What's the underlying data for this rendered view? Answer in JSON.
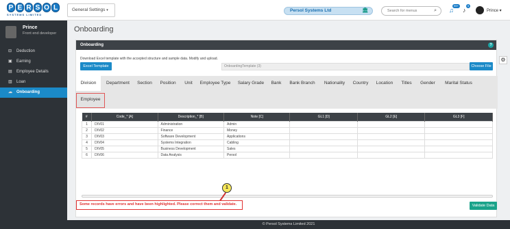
{
  "header": {
    "logo_text": "PERSOL",
    "logo_sub": "SYSTEMS LIMITED",
    "settings_menu": "General Settings",
    "company": "Persol Systems Ltd",
    "search_placeholder": "Search for menus",
    "notif_count": "99+",
    "alerts_count": "5",
    "user": "Prince"
  },
  "sidebar": {
    "name": "Prince",
    "role": "Front end developer",
    "items": [
      {
        "label": "Deduction",
        "icon": "minus-square-icon"
      },
      {
        "label": "Earning",
        "icon": "money-icon"
      },
      {
        "label": "Employee Details",
        "icon": "id-card-icon"
      },
      {
        "label": "Loan",
        "icon": "loan-icon"
      },
      {
        "label": "Onboarding",
        "icon": "cloud-upload-icon",
        "active": true
      }
    ]
  },
  "main": {
    "title": "Onboarding",
    "panel_title": "Onboarding",
    "download_text": "Download Excel template with the accepted structure and sample data. Modify and upload.",
    "excel_button": "Excel Template",
    "file_name": "OnboardingTemplate (3)",
    "choose_button": "Choose File",
    "tabs": [
      "Division",
      "Department",
      "Section",
      "Position",
      "Unit",
      "Employee Type",
      "Salary Grade",
      "Bank",
      "Bank Branch",
      "Nationality",
      "Country",
      "Location",
      "Titles",
      "Gender",
      "Marital Status"
    ],
    "tab_employee": "Employee",
    "table": {
      "headers": [
        "#",
        "Code_* [A]",
        "Description_* [B]",
        "Note [C]",
        "GL1 [D]",
        "GL2 [E]",
        "GL3 [F]"
      ],
      "rows": [
        [
          "1",
          "DIV01",
          "Administration",
          "Admin",
          "",
          "",
          ""
        ],
        [
          "2",
          "DIV02",
          "Finance",
          "Money",
          "",
          "",
          ""
        ],
        [
          "3",
          "DIV03",
          "Software Development",
          "Applications",
          "",
          "",
          ""
        ],
        [
          "4",
          "DIV04",
          "Systems Integration",
          "Cabling",
          "",
          "",
          ""
        ],
        [
          "5",
          "DIV05",
          "Business Development",
          "Sales",
          "",
          "",
          ""
        ],
        [
          "6",
          "DIV06",
          "Data Analysis",
          "Persol",
          "",
          "",
          ""
        ]
      ]
    },
    "error_message": "Some records have errors and have been highlighted. Please correct them and validate.",
    "callout_number": "1",
    "validate_button": "Validate Data"
  },
  "footer": {
    "text": "© Persol Systems Limited 2021"
  },
  "colors": {
    "accent": "#1b8ac8",
    "sidebar": "#2d3237",
    "error": "#e03030",
    "validate": "#1aa38a"
  }
}
